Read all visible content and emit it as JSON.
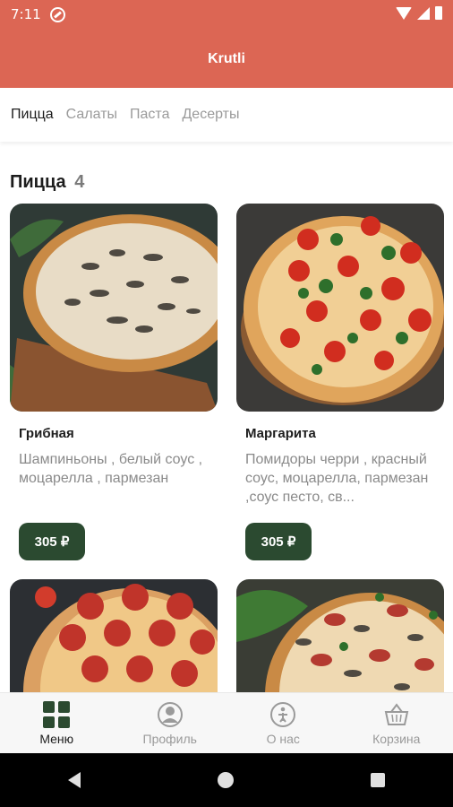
{
  "status_bar": {
    "time": "7:11"
  },
  "app": {
    "title": "Krutli"
  },
  "tabs": [
    {
      "label": "Пицца",
      "active": true
    },
    {
      "label": "Салаты",
      "active": false
    },
    {
      "label": "Паста",
      "active": false
    },
    {
      "label": "Десерты",
      "active": false
    }
  ],
  "section": {
    "title": "Пицца",
    "count": "4"
  },
  "products": [
    {
      "name": "Грибная",
      "description": "Шампиньоны , белый соус , моцарелла , пармезан",
      "price": "305 ₽"
    },
    {
      "name": "Маргарита",
      "description": "Помидоры черри , красный соус, моцарелла, пармезан ,соус песто, св...",
      "price": "305 ₽"
    },
    {
      "name": "",
      "description": "",
      "price": ""
    },
    {
      "name": "",
      "description": "",
      "price": ""
    }
  ],
  "bottom_nav": [
    {
      "label": "Меню",
      "icon": "grid-icon",
      "active": true
    },
    {
      "label": "Профиль",
      "icon": "profile-icon",
      "active": false
    },
    {
      "label": "О нас",
      "icon": "info-icon",
      "active": false
    },
    {
      "label": "Корзина",
      "icon": "basket-icon",
      "active": false
    }
  ],
  "colors": {
    "header": "#dc6654",
    "accent": "#2b4a30",
    "muted": "#9a9a9a"
  }
}
